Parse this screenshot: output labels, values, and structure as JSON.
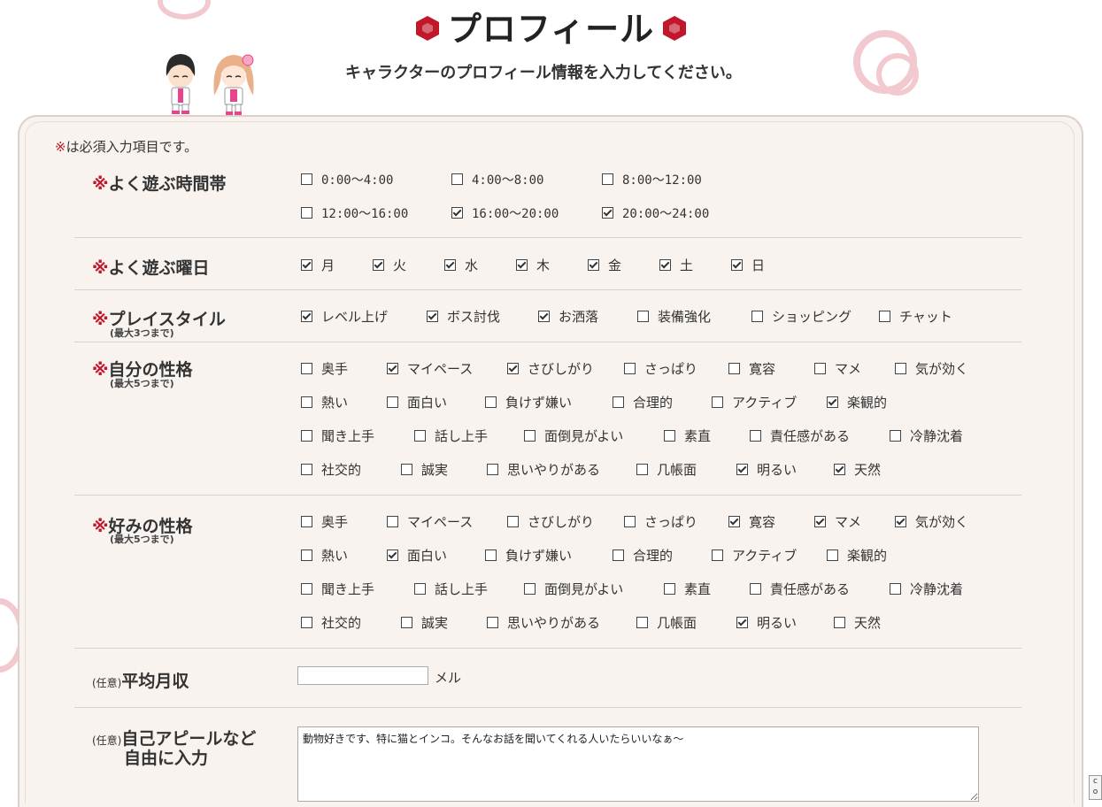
{
  "header": {
    "title": "プロフィール",
    "subtitle": "キャラクターのプロフィール情報を入力してください。"
  },
  "required_note": {
    "mark": "※",
    "text": "は必須入力項目です。"
  },
  "sections": {
    "play_time": {
      "mark": "※",
      "label": "よく遊ぶ時間帯",
      "options": [
        {
          "label": "0:00〜4:00",
          "checked": false
        },
        {
          "label": "4:00〜8:00",
          "checked": false
        },
        {
          "label": "8:00〜12:00",
          "checked": false
        },
        {
          "label": "12:00〜16:00",
          "checked": false
        },
        {
          "label": "16:00〜20:00",
          "checked": true
        },
        {
          "label": "20:00〜24:00",
          "checked": true
        }
      ]
    },
    "play_days": {
      "mark": "※",
      "label": "よく遊ぶ曜日",
      "options": [
        {
          "label": "月",
          "checked": true
        },
        {
          "label": "火",
          "checked": true
        },
        {
          "label": "水",
          "checked": true
        },
        {
          "label": "木",
          "checked": true
        },
        {
          "label": "金",
          "checked": true
        },
        {
          "label": "土",
          "checked": true
        },
        {
          "label": "日",
          "checked": true
        }
      ]
    },
    "play_style": {
      "mark": "※",
      "label": "プレイスタイル",
      "sublabel": "(最大3つまで)",
      "options": [
        {
          "label": "レベル上げ",
          "checked": true
        },
        {
          "label": "ボス討伐",
          "checked": true
        },
        {
          "label": "お洒落",
          "checked": true
        },
        {
          "label": "装備強化",
          "checked": false
        },
        {
          "label": "ショッピング",
          "checked": false
        },
        {
          "label": "チャット",
          "checked": false
        }
      ]
    },
    "my_personality": {
      "mark": "※",
      "label": "自分の性格",
      "sublabel": "(最大5つまで)",
      "options": [
        {
          "label": "奥手",
          "checked": false
        },
        {
          "label": "マイペース",
          "checked": true
        },
        {
          "label": "さびしがり",
          "checked": true
        },
        {
          "label": "さっぱり",
          "checked": false
        },
        {
          "label": "寛容",
          "checked": false
        },
        {
          "label": "マメ",
          "checked": false
        },
        {
          "label": "気が効く",
          "checked": false
        },
        {
          "label": "熱い",
          "checked": false
        },
        {
          "label": "面白い",
          "checked": false
        },
        {
          "label": "負けず嫌い",
          "checked": false
        },
        {
          "label": "合理的",
          "checked": false
        },
        {
          "label": "アクティブ",
          "checked": false
        },
        {
          "label": "楽観的",
          "checked": true
        },
        {
          "label": "聞き上手",
          "checked": false
        },
        {
          "label": "話し上手",
          "checked": false
        },
        {
          "label": "面倒見がよい",
          "checked": false
        },
        {
          "label": "素直",
          "checked": false
        },
        {
          "label": "責任感がある",
          "checked": false
        },
        {
          "label": "冷静沈着",
          "checked": false
        },
        {
          "label": "社交的",
          "checked": false
        },
        {
          "label": "誠実",
          "checked": false
        },
        {
          "label": "思いやりがある",
          "checked": false
        },
        {
          "label": "几帳面",
          "checked": false
        },
        {
          "label": "明るい",
          "checked": true
        },
        {
          "label": "天然",
          "checked": true
        }
      ]
    },
    "preferred_personality": {
      "mark": "※",
      "label": "好みの性格",
      "sublabel": "(最大5つまで)",
      "options": [
        {
          "label": "奥手",
          "checked": false
        },
        {
          "label": "マイペース",
          "checked": false
        },
        {
          "label": "さびしがり",
          "checked": false
        },
        {
          "label": "さっぱり",
          "checked": false
        },
        {
          "label": "寛容",
          "checked": true
        },
        {
          "label": "マメ",
          "checked": true
        },
        {
          "label": "気が効く",
          "checked": true
        },
        {
          "label": "熱い",
          "checked": false
        },
        {
          "label": "面白い",
          "checked": true
        },
        {
          "label": "負けず嫌い",
          "checked": false
        },
        {
          "label": "合理的",
          "checked": false
        },
        {
          "label": "アクティブ",
          "checked": false
        },
        {
          "label": "楽観的",
          "checked": false
        },
        {
          "label": "聞き上手",
          "checked": false
        },
        {
          "label": "話し上手",
          "checked": false
        },
        {
          "label": "面倒見がよい",
          "checked": false
        },
        {
          "label": "素直",
          "checked": false
        },
        {
          "label": "責任感がある",
          "checked": false
        },
        {
          "label": "冷静沈着",
          "checked": false
        },
        {
          "label": "社交的",
          "checked": false
        },
        {
          "label": "誠実",
          "checked": false
        },
        {
          "label": "思いやりがある",
          "checked": false
        },
        {
          "label": "几帳面",
          "checked": false
        },
        {
          "label": "明るい",
          "checked": true
        },
        {
          "label": "天然",
          "checked": false
        }
      ]
    },
    "income": {
      "optional": "(任意)",
      "label": "平均月収",
      "value": "",
      "unit": "メル"
    },
    "appeal": {
      "optional": "(任意)",
      "label_line1": "自己アピールなど",
      "label_line2": "自由に入力",
      "value": "動物好きです、特に猫とインコ。そんなお話を聞いてくれる人いたらいいなぁ〜"
    }
  },
  "scroll_button": {
    "line1": "c",
    "line2": "o"
  },
  "colors": {
    "accent": "#c0182a",
    "panel_bg": "#f8f3ef",
    "border": "#dcd0c8"
  },
  "icons": {
    "title_marker": "red-hexagon-icon",
    "decoration": "knot-ornament-icon"
  }
}
